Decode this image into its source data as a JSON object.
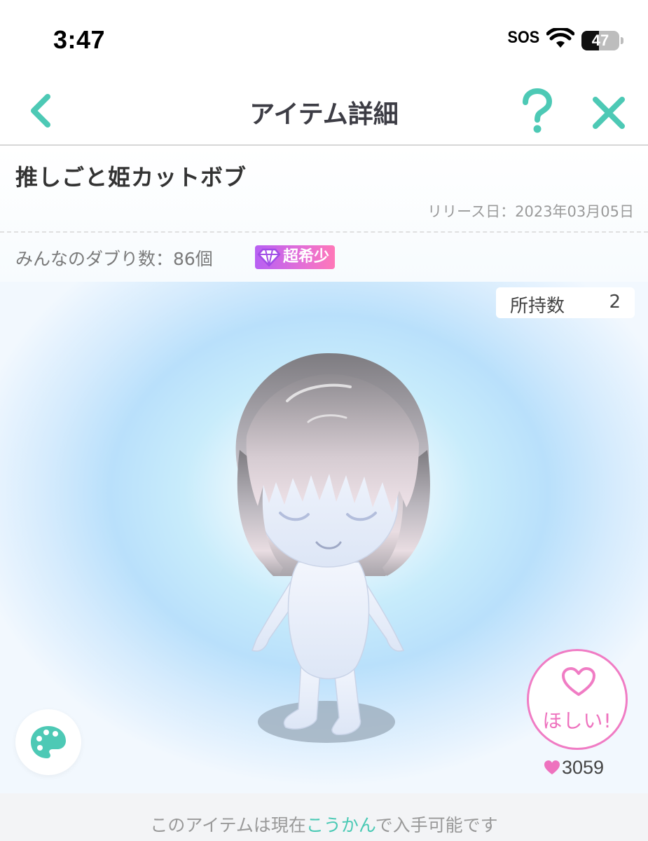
{
  "status_bar": {
    "time": "3:47",
    "sos": "SOS",
    "battery_level": "47",
    "battery_fraction": 0.47
  },
  "nav": {
    "title": "アイテム詳細",
    "back_icon": "chevron-left-icon",
    "help_icon": "question-icon",
    "close_icon": "close-icon",
    "accent_color": "#4dc9b5"
  },
  "item": {
    "name": "推しごと姫カットボブ",
    "release_date": "リリース日：2023年03月05日",
    "duplicate_count": "みんなのダブり数：86個",
    "rarity": "超希少",
    "rarity_icon": "diamond-icon"
  },
  "owned": {
    "label": "所持数",
    "value": "2"
  },
  "want": {
    "label": "ほしい!",
    "count": "3059",
    "color": "#f07cc4"
  },
  "palette": {
    "icon": "palette-icon"
  },
  "bottom_note": {
    "before": "このアイテムは現在",
    "link": "こうかん",
    "after": "で入手可能です",
    "link_color": "#49c9b4"
  }
}
